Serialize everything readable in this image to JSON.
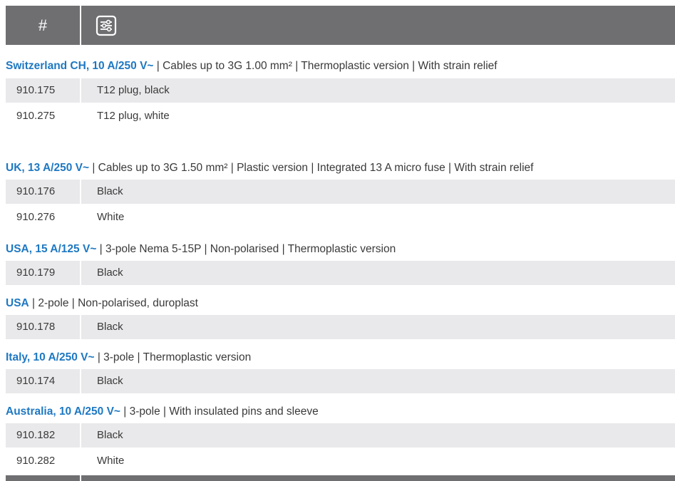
{
  "header": {
    "col1_label": "#",
    "col2_icon": "filter-sliders-icon"
  },
  "sections": [
    {
      "title_highlight": "Switzerland CH, 10 A/250 V~",
      "title_rest": " | Cables up to 3G 1.00 mm² | Thermoplastic version | With strain relief",
      "rows": [
        {
          "number": "910.175",
          "description": "T12 plug, black"
        },
        {
          "number": "910.275",
          "description": "T12 plug, white"
        }
      ]
    },
    {
      "title_highlight": "UK, 13 A/250 V~",
      "title_rest": " | Cables up to 3G 1.50 mm² | Plastic version | Integrated 13 A micro fuse | With strain relief",
      "rows": [
        {
          "number": "910.176",
          "description": "Black"
        },
        {
          "number": "910.276",
          "description": "White"
        }
      ]
    },
    {
      "title_highlight": "USA, 15 A/125 V~",
      "title_rest": " | 3-pole Nema 5-15P | Non-polarised | Thermoplastic version",
      "rows": [
        {
          "number": "910.179",
          "description": "Black"
        }
      ]
    },
    {
      "title_highlight": "USA",
      "title_rest": " | 2-pole | Non-polarised, duroplast",
      "rows": [
        {
          "number": "910.178",
          "description": "Black"
        }
      ]
    },
    {
      "title_highlight": "Italy, 10 A/250 V~",
      "title_rest": " | 3-pole | Thermoplastic version",
      "rows": [
        {
          "number": "910.174",
          "description": "Black"
        }
      ]
    },
    {
      "title_highlight": "Australia, 10 A/250 V~",
      "title_rest": " | 3-pole | With insulated pins and sleeve",
      "rows": [
        {
          "number": "910.182",
          "description": "Black"
        },
        {
          "number": "910.282",
          "description": "White"
        }
      ]
    }
  ],
  "colors": {
    "header_bg": "#6f6f72",
    "accent_blue": "#1e78c2",
    "row_shade": "#e9e9eb",
    "text": "#3a3a3a"
  }
}
